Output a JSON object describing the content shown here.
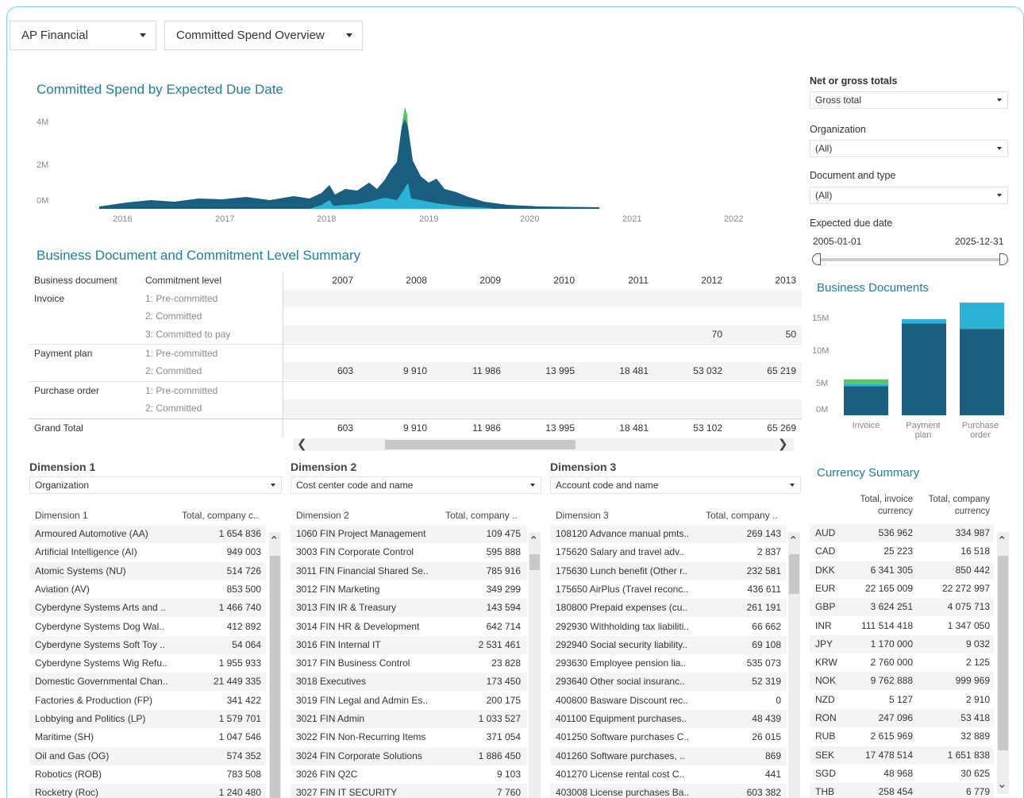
{
  "toolbar": {
    "workbook": "AP Financial",
    "view": "Committed Spend Overview"
  },
  "area_chart": {
    "title": "Committed Spend by Expected Due Date",
    "y_ticks": [
      "4M",
      "2M",
      "0M"
    ],
    "x_ticks": [
      "2016",
      "2017",
      "2018",
      "2019",
      "2020",
      "2021",
      "2022"
    ]
  },
  "filters": {
    "net_gross": {
      "label": "Net or gross totals",
      "value": "Gross total"
    },
    "organization": {
      "label": "Organization",
      "value": "(All)"
    },
    "doc_type": {
      "label": "Document and type",
      "value": "(All)"
    },
    "due_date": {
      "label": "Expected due date",
      "start": "2005-01-01",
      "end": "2025-12-31",
      "range": [
        0,
        1
      ]
    }
  },
  "summary": {
    "title": "Business Document and Commitment Level Summary",
    "col_doc": "Business document",
    "col_level": "Commitment level",
    "years": [
      "2007",
      "2008",
      "2009",
      "2010",
      "2011",
      "2012",
      "2013"
    ],
    "rows": [
      {
        "doc": "Invoice",
        "level": "1: Pre-committed",
        "values": [
          "",
          "",
          "",
          "",
          "",
          "",
          ""
        ]
      },
      {
        "doc": "",
        "level": "2: Committed",
        "values": [
          "",
          "",
          "",
          "",
          "",
          "",
          ""
        ]
      },
      {
        "doc": "",
        "level": "3: Committed to pay",
        "values": [
          "",
          "",
          "",
          "",
          "",
          "70",
          "50"
        ]
      },
      {
        "doc": "Payment plan",
        "level": "1: Pre-committed",
        "values": [
          "",
          "",
          "",
          "",
          "",
          "",
          ""
        ]
      },
      {
        "doc": "",
        "level": "2: Committed",
        "values": [
          "603",
          "9 910",
          "11 986",
          "13 995",
          "18 481",
          "53 032",
          "65 219"
        ]
      },
      {
        "doc": "Purchase order",
        "level": "1: Pre-committed",
        "values": [
          "",
          "",
          "",
          "",
          "",
          "",
          ""
        ]
      },
      {
        "doc": "",
        "level": "2: Committed",
        "values": [
          "",
          "",
          "",
          "",
          "",
          "",
          ""
        ]
      }
    ],
    "grand_total_label": "Grand Total",
    "grand_total": [
      "603",
      "9 910",
      "11 986",
      "13 995",
      "18 481",
      "53 102",
      "65 269"
    ]
  },
  "business_docs": {
    "title": "Business Documents",
    "y_ticks": [
      "15M",
      "10M",
      "5M",
      "0M"
    ],
    "ylim": [
      0,
      17000000
    ],
    "categories": [
      "Invoice",
      "Payment plan",
      "Purchase order"
    ],
    "colors": [
      "#1a5e80",
      "#2ab3d4",
      "#5cc06a"
    ]
  },
  "chart_data": {
    "type": "bar",
    "categories": [
      "Invoice",
      "Payment plan",
      "Purchase order"
    ],
    "series": [
      {
        "values": [
          4200000,
          13300000,
          12500000
        ]
      },
      {
        "values": [
          300000,
          600000,
          3800000
        ]
      },
      {
        "values": [
          700000,
          0,
          0
        ]
      }
    ],
    "ylim": [
      0,
      17000000
    ],
    "title": "Business Documents"
  },
  "dimension1": {
    "title": "Dimension 1",
    "select": "Organization",
    "col_name": "Dimension 1",
    "col_total": "Total, company c..",
    "rows": [
      [
        "Armoured Automotive (AA)",
        "1 654 836"
      ],
      [
        "Artificial Intelligence (AI)",
        "949 003"
      ],
      [
        "Atomic Systems (NU)",
        "514 726"
      ],
      [
        "Aviation (AV)",
        "853 500"
      ],
      [
        "Cyberdyne Systems Arts and ..",
        "1 466 740"
      ],
      [
        "Cyberdyne Systems Dog Wal..",
        "412 892"
      ],
      [
        "Cyberdyne Systems Soft Toy ..",
        "54 064"
      ],
      [
        "Cyberdyne Systems Wig Refu..",
        "1 955 933"
      ],
      [
        "Domestic Governmental Chan..",
        "21 449 335"
      ],
      [
        "Factories & Production (FP)",
        "341 422"
      ],
      [
        "Lobbying and Politics (LP)",
        "1 579 701"
      ],
      [
        "Maritime (SH)",
        "1 047 546"
      ],
      [
        "Oil and Gas (OG)",
        "574 352"
      ],
      [
        "Robotics (ROB)",
        "783 508"
      ],
      [
        "Rocketry (Roc)",
        "1 240 480"
      ]
    ]
  },
  "dimension2": {
    "title": "Dimension 2",
    "select": "Cost center code and name",
    "col_name": "Dimension 2",
    "col_total": "Total, company ..",
    "rows": [
      [
        "1060 FIN Project Management",
        "109 475"
      ],
      [
        "3003 FIN Corporate Control",
        "595 888"
      ],
      [
        "3011 FIN Financial Shared Se..",
        "785 916"
      ],
      [
        "3012 FIN Marketing",
        "349 299"
      ],
      [
        "3013 FIN IR & Treasury",
        "143 594"
      ],
      [
        "3014 FIN HR & Development",
        "642 714"
      ],
      [
        "3016 FIN Internal IT",
        "2 531 461"
      ],
      [
        "3017 FIN Business Control",
        "23 828"
      ],
      [
        "3018 Executives",
        "173 450"
      ],
      [
        "3019 FIN Legal and Admin Es..",
        "200 175"
      ],
      [
        "3021 FIN Admin",
        "1 033 527"
      ],
      [
        "3022 FIN Non-Recurring Items",
        "371 054"
      ],
      [
        "3024 FIN Corporate Solutions",
        "1 886 450"
      ],
      [
        "3026 FIN Q2C",
        "9 103"
      ],
      [
        "3027 FIN IT SECURITY",
        "7 760"
      ]
    ]
  },
  "dimension3": {
    "title": "Dimension 3",
    "select": "Account code and name",
    "col_name": "Dimension 3",
    "col_total": "Total, company ..",
    "rows": [
      [
        "108120 Advance manual pmts..",
        "269 143"
      ],
      [
        "175620 Salary and travel adv..",
        "2 837"
      ],
      [
        "175630 Lunch benefit (Other r..",
        "232 581"
      ],
      [
        "175650 AirPlus (Travel reconc..",
        "436 611"
      ],
      [
        "180800 Prepaid expenses (cu..",
        "261 191"
      ],
      [
        "292930 Withholding tax liabiliti..",
        "66 662"
      ],
      [
        "292940 Social security liability..",
        "69 108"
      ],
      [
        "293630 Employee pension lia..",
        "535 073"
      ],
      [
        "293640 Other social insuranc..",
        "52 319"
      ],
      [
        "400800 Basware Discount rec..",
        "0"
      ],
      [
        "401100 Equipment purchases..",
        "48 439"
      ],
      [
        "401250 Software purchases C..",
        "26 015"
      ],
      [
        "401260 Software purchases, ..",
        "869"
      ],
      [
        "401270 License rental cost C..",
        "441"
      ],
      [
        "403008 License purchases Ba..",
        "603 382"
      ]
    ]
  },
  "currency": {
    "title": "Currency Summary",
    "col_invoice": [
      "Total, invoice",
      "currency"
    ],
    "col_company": [
      "Total, company",
      "currency"
    ],
    "rows": [
      [
        "AUD",
        "536 962",
        "334 987"
      ],
      [
        "CAD",
        "25 223",
        "16 518"
      ],
      [
        "DKK",
        "6 341 305",
        "850 442"
      ],
      [
        "EUR",
        "22 165 009",
        "22 272 997"
      ],
      [
        "GBP",
        "3 624 251",
        "4 075 713"
      ],
      [
        "INR",
        "111 514 418",
        "1 347 050"
      ],
      [
        "JPY",
        "1 170 000",
        "9 032"
      ],
      [
        "KRW",
        "2 760 000",
        "2 125"
      ],
      [
        "NOK",
        "9 762 888",
        "999 969"
      ],
      [
        "NZD",
        "5 127",
        "2 910"
      ],
      [
        "RON",
        "247 096",
        "53 418"
      ],
      [
        "RUB",
        "2 615 969",
        "32 889"
      ],
      [
        "SEK",
        "17 478 514",
        "1 651 838"
      ],
      [
        "SGD",
        "48 968",
        "30 625"
      ],
      [
        "THB",
        "258 454",
        "6 779"
      ]
    ]
  }
}
